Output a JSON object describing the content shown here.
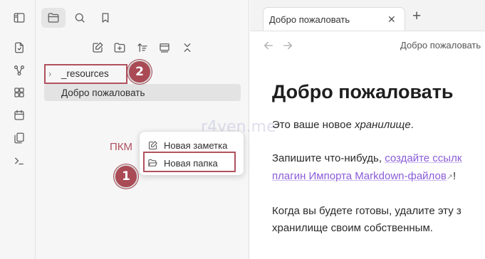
{
  "left_ribbon": {
    "icons": [
      "sidebar-toggle-icon",
      "open-file-icon",
      "graph-icon",
      "canvas-icon",
      "calendar-icon",
      "templates-icon",
      "terminal-icon"
    ]
  },
  "sidebar": {
    "top_icons": [
      "folder-icon",
      "search-icon",
      "bookmark-icon"
    ],
    "toolbar_icons": [
      "new-note-icon",
      "new-folder-icon",
      "sort-icon",
      "collapse-view-icon",
      "collapse-all-icon"
    ],
    "tree": {
      "folder": "_resources",
      "file": "Добро пожаловать"
    }
  },
  "context_menu": {
    "items": [
      {
        "label": "Новая заметка",
        "icon": "edit-icon"
      },
      {
        "label": "Новая папка",
        "icon": "folder-open-icon"
      }
    ]
  },
  "annotations": {
    "rmb_label": "ПКМ",
    "badge_1": "1",
    "badge_2": "2",
    "watermark": "r4ven.me",
    "color": "#b0515e"
  },
  "tabs": {
    "active_title": "Добро пожаловать",
    "close_label": "✕",
    "new_tab_label": "+"
  },
  "view_header": {
    "title": "Добро пожаловать"
  },
  "document": {
    "heading": "Добро пожаловать",
    "p1_before": "Это ваше новое ",
    "p1_italic": "хранилище",
    "p1_after": ".",
    "p2_before": "Запишите что-нибудь, ",
    "p2_link1": "создайте ссылк",
    "p2_link2": "плагин Импорта Markdown-файлов",
    "p2_after": "!",
    "p3_line1": "Когда вы будете готовы, удалите эту з",
    "p3_line2": "хранилище своим собственным."
  }
}
